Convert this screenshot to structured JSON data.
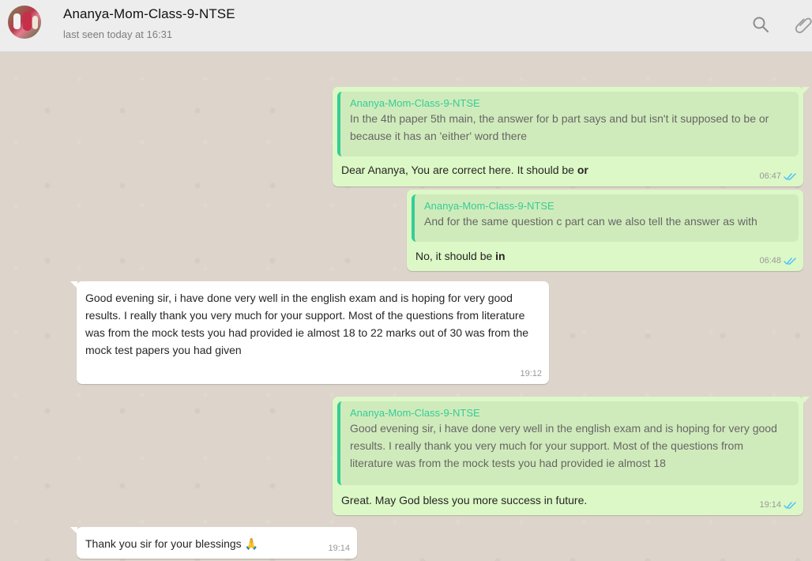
{
  "header": {
    "title": "Ananya-Mom-Class-9-NTSE",
    "last_seen": "last seen today at 16:31",
    "icons": [
      "search-icon",
      "paperclip-icon"
    ]
  },
  "messages": [
    {
      "quote_author": "Ananya-Mom-Class-9-NTSE",
      "quote_text": "In the 4th paper 5th main, the answer for b part says and but isn't it supposed to be or because it has an 'either' word there",
      "reply_prefix": "Dear Ananya, You are correct here. It should be ",
      "reply_bold": "or",
      "time": "06:47"
    },
    {
      "quote_author": "Ananya-Mom-Class-9-NTSE",
      "quote_text": "And for the same question c part can we also tell the answer as with",
      "reply_prefix": "No, it should be ",
      "reply_bold": "in",
      "time": "06:48"
    },
    {
      "text": "Good evening sir, i have done very well in the english exam and is hoping for very good results. I really thank you very much for your support. Most of the questions from literature was from the mock tests you had provided ie almost 18 to 22 marks out of 30 was from the mock test papers you had given",
      "time": "19:12"
    },
    {
      "quote_author": "Ananya-Mom-Class-9-NTSE",
      "quote_text": "Good evening sir, i have done very well in the english exam and is hoping for very good results. I really thank you very much for your support. Most of the questions from literature was from the mock tests you had provided ie almost 18",
      "reply_text": "Great. May God bless you more success in future.",
      "time": "19:14"
    },
    {
      "text": "Thank you sir for your blessings",
      "emoji": "🙏",
      "time": "19:14"
    }
  ],
  "colors": {
    "outgoing_bubble": "#dcf8c6",
    "incoming_bubble": "#ffffff",
    "quote_accent": "#35cd96",
    "read_tick": "#4fc3f7"
  }
}
